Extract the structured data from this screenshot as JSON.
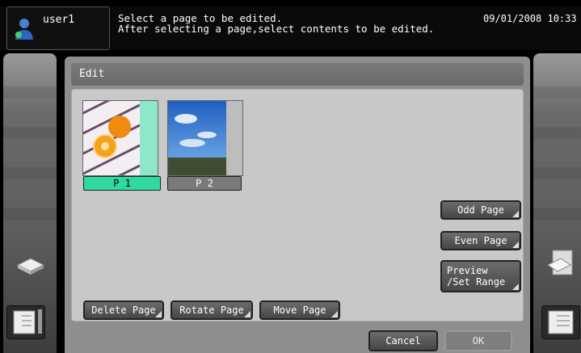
{
  "header": {
    "user": "user1",
    "message_line1": "Select a page to be edited.",
    "message_line2": "After selecting a page,select contents to be edited.",
    "datetime": "09/01/2008 10:33"
  },
  "main": {
    "title": "Edit",
    "pages": [
      {
        "label": "P 1",
        "selected": true
      },
      {
        "label": "P 2",
        "selected": false
      }
    ],
    "side_buttons": {
      "odd_page": "Odd Page",
      "even_page": "Even Page",
      "preview_set_range": "Preview\n/Set Range"
    },
    "page_actions": {
      "delete_page": "Delete Page",
      "rotate_page": "Rotate Page",
      "move_page": "Move Page"
    }
  },
  "footer": {
    "cancel": "Cancel",
    "ok": "OK"
  },
  "colors": {
    "accent": "#2fd9a0",
    "panel": "#8e8e8e",
    "content": "#c8c8c8"
  }
}
